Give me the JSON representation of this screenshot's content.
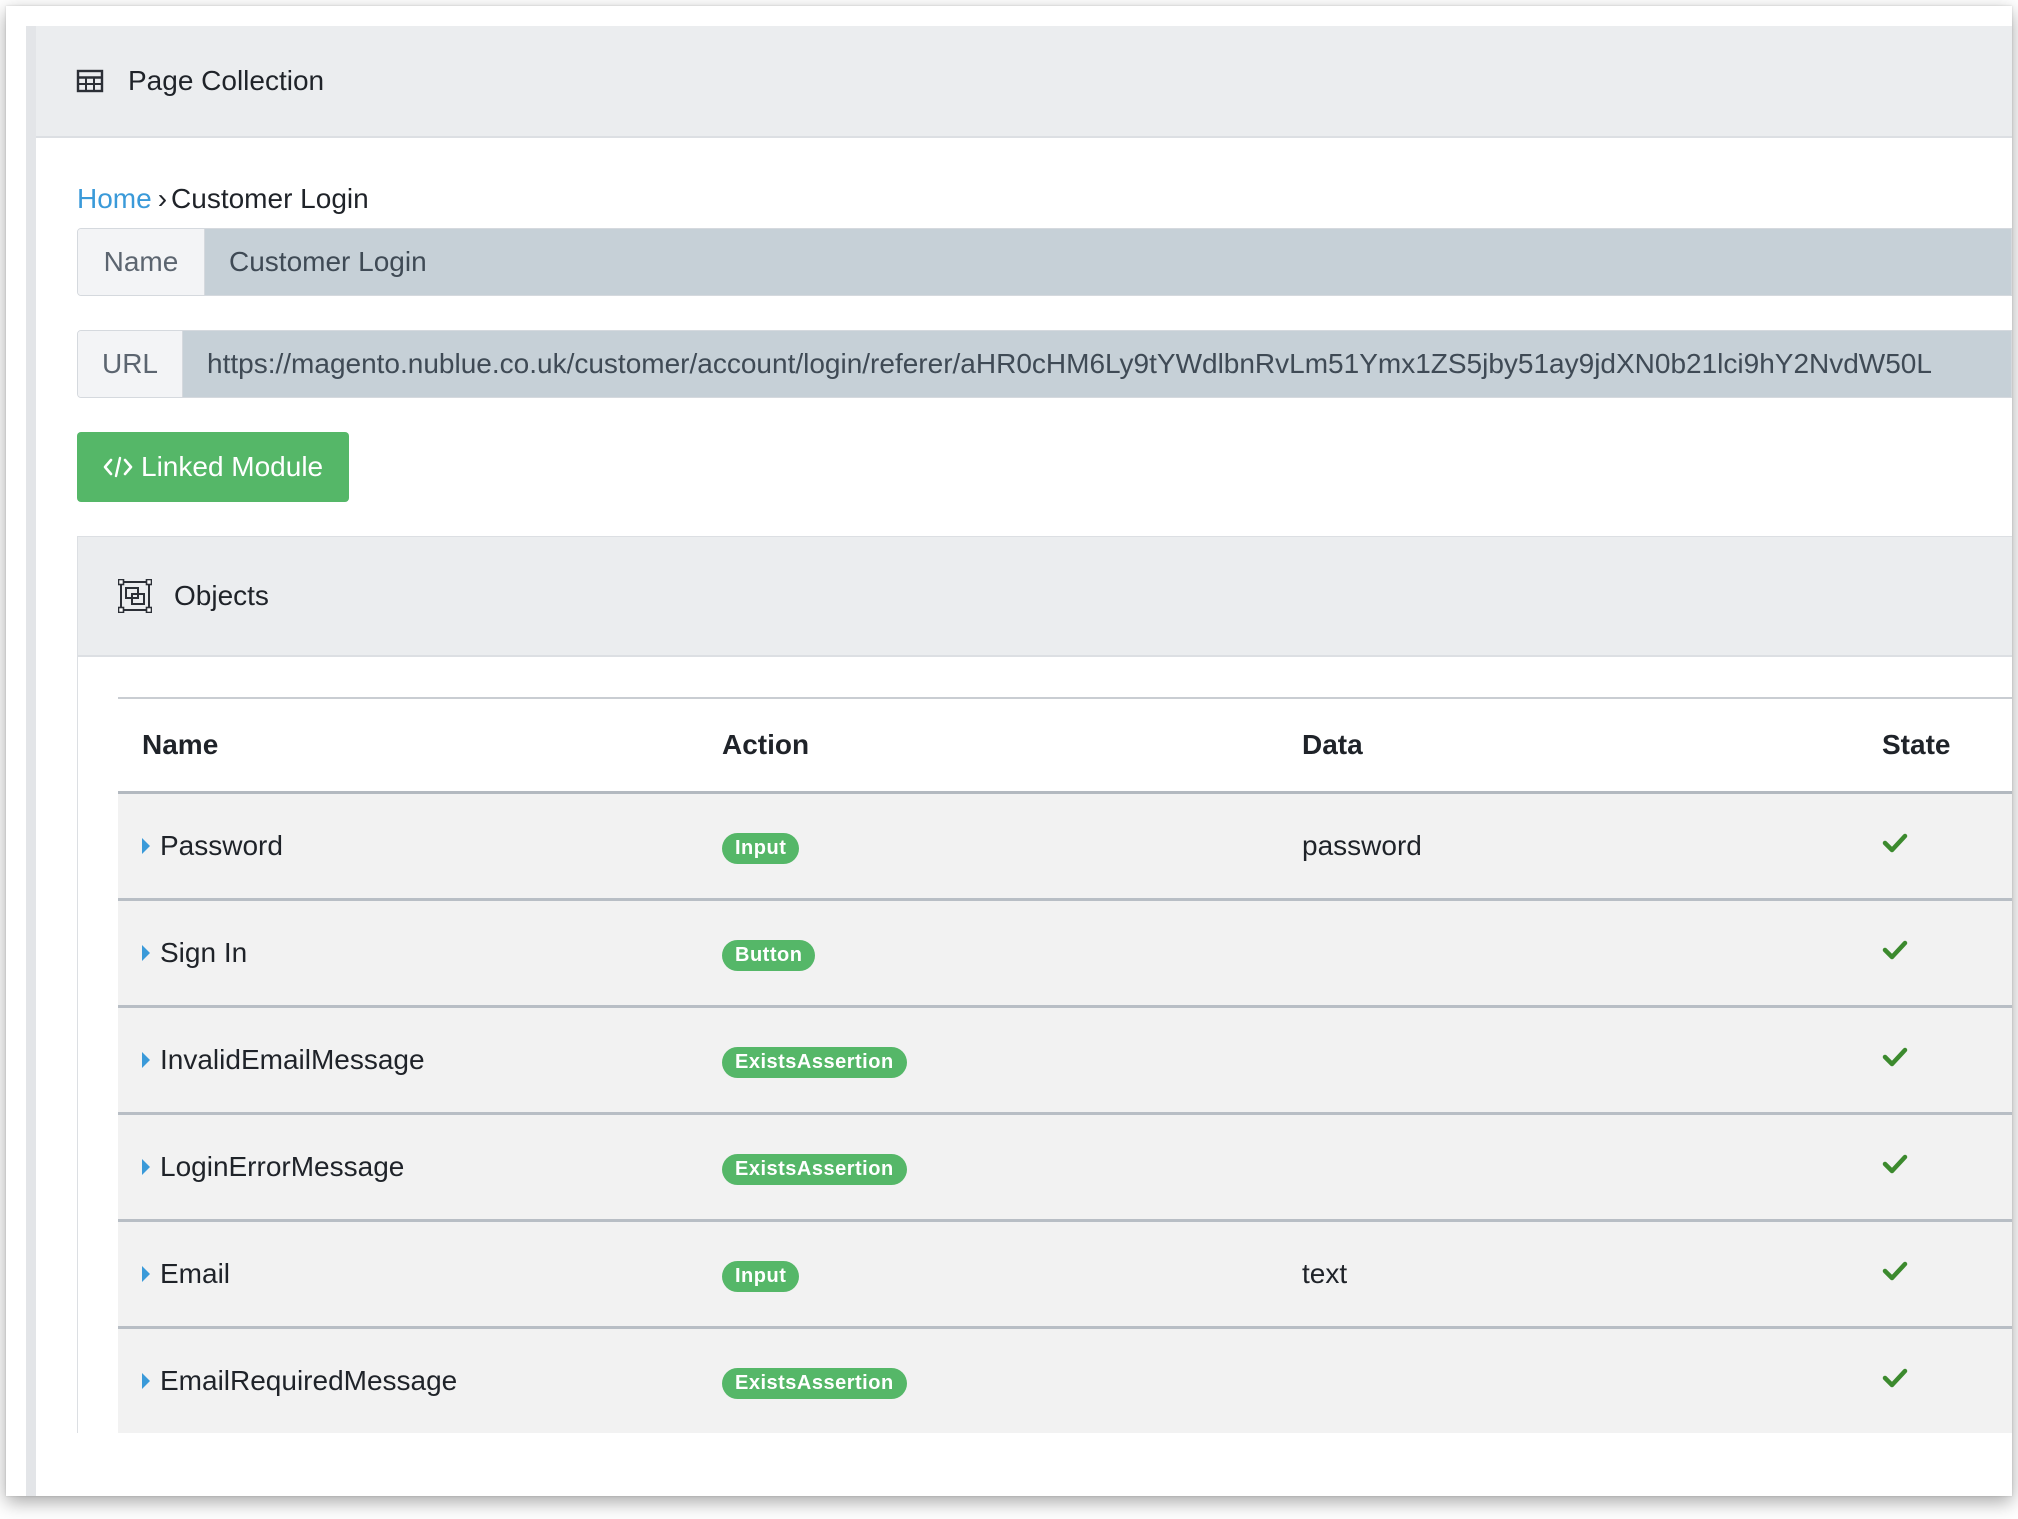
{
  "panel": {
    "title": "Page Collection",
    "icon": "table-icon"
  },
  "breadcrumb": {
    "home": "Home",
    "separator": "›",
    "current": "Customer Login"
  },
  "name_field": {
    "label": "Name",
    "value": "Customer Login"
  },
  "url_field": {
    "label": "URL",
    "value": "https://magento.nublue.co.uk/customer/account/login/referer/aHR0cHM6Ly9tYWdlbnRvLm51Ymx1ZS5jby51ay9jdXN0b21lci9hY2NvdW50L"
  },
  "linked_module_button": {
    "label": "Linked Module",
    "icon": "code-icon"
  },
  "objects": {
    "title": "Objects",
    "icon": "object-group-icon",
    "columns": [
      "Name",
      "Action",
      "Data",
      "State"
    ],
    "rows": [
      {
        "name": "Password",
        "action": "Input",
        "data": "password",
        "state": "check-icon"
      },
      {
        "name": "Sign In",
        "action": "Button",
        "data": "",
        "state": "check-icon"
      },
      {
        "name": "InvalidEmailMessage",
        "action": "ExistsAssertion",
        "data": "",
        "state": "check-icon"
      },
      {
        "name": "LoginErrorMessage",
        "action": "ExistsAssertion",
        "data": "",
        "state": "check-icon"
      },
      {
        "name": "Email",
        "action": "Input",
        "data": "text",
        "state": "check-icon"
      },
      {
        "name": "EmailRequiredMessage",
        "action": "ExistsAssertion",
        "data": "",
        "state": "check-icon"
      }
    ]
  },
  "colors": {
    "accent_green": "#55b768",
    "link_blue": "#3a9ad9",
    "check_green": "#3c8a2e"
  }
}
